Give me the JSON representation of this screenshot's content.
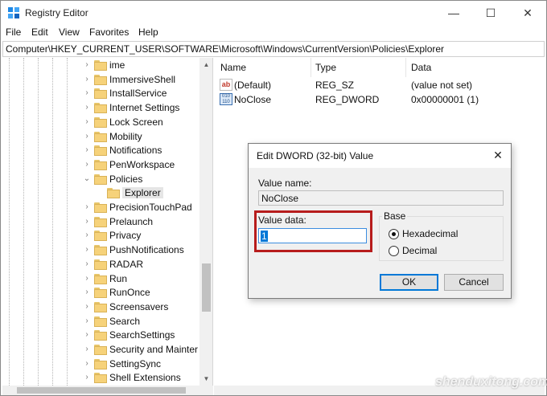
{
  "window": {
    "title": "Registry Editor",
    "controls": {
      "minimize": "—",
      "maximize": "☐",
      "close": "✕"
    }
  },
  "menu": [
    "File",
    "Edit",
    "View",
    "Favorites",
    "Help"
  ],
  "address": "Computer\\HKEY_CURRENT_USER\\SOFTWARE\\Microsoft\\Windows\\CurrentVersion\\Policies\\Explorer",
  "tree": [
    {
      "label": "ime",
      "chevron": ">"
    },
    {
      "label": "ImmersiveShell",
      "chevron": ">"
    },
    {
      "label": "InstallService",
      "chevron": ">"
    },
    {
      "label": "Internet Settings",
      "chevron": ">"
    },
    {
      "label": "Lock Screen",
      "chevron": ">"
    },
    {
      "label": "Mobility",
      "chevron": ">"
    },
    {
      "label": "Notifications",
      "chevron": ">"
    },
    {
      "label": "PenWorkspace",
      "chevron": ">"
    },
    {
      "label": "Policies",
      "chevron": "v"
    },
    {
      "label": "Explorer",
      "chevron": "",
      "child": true,
      "selected": true
    },
    {
      "label": "PrecisionTouchPad",
      "chevron": ">"
    },
    {
      "label": "Prelaunch",
      "chevron": ">"
    },
    {
      "label": "Privacy",
      "chevron": ">"
    },
    {
      "label": "PushNotifications",
      "chevron": ">"
    },
    {
      "label": "RADAR",
      "chevron": ">"
    },
    {
      "label": "Run",
      "chevron": ">"
    },
    {
      "label": "RunOnce",
      "chevron": ">"
    },
    {
      "label": "Screensavers",
      "chevron": ">"
    },
    {
      "label": "Search",
      "chevron": ">"
    },
    {
      "label": "SearchSettings",
      "chevron": ">"
    },
    {
      "label": "Security and Mainter",
      "chevron": ">"
    },
    {
      "label": "SettingSync",
      "chevron": ">"
    },
    {
      "label": "Shell Extensions",
      "chevron": ">"
    }
  ],
  "list": {
    "columns": {
      "name": "Name",
      "type": "Type",
      "data": "Data"
    },
    "rows": [
      {
        "icon": "string-value-icon",
        "icon_text": "ab",
        "name": "(Default)",
        "type": "REG_SZ",
        "data": "(value not set)"
      },
      {
        "icon": "dword-value-icon",
        "icon_text": "010 110",
        "name": "NoClose",
        "type": "REG_DWORD",
        "data": "0x00000001 (1)"
      }
    ]
  },
  "dialog": {
    "title": "Edit DWORD (32-bit) Value",
    "close": "✕",
    "value_name_label": "Value name:",
    "value_name": "NoClose",
    "value_data_label": "Value data:",
    "value_data": "1",
    "base_label": "Base",
    "base_options": [
      "Hexadecimal",
      "Decimal"
    ],
    "base_selected": "Hexadecimal",
    "ok_label": "OK",
    "cancel_label": "Cancel"
  },
  "colors": {
    "highlight_border": "#b71c1c",
    "selection": "#0078d7",
    "folder": "#f6d27a"
  },
  "watermark": "shenduxitong.com"
}
